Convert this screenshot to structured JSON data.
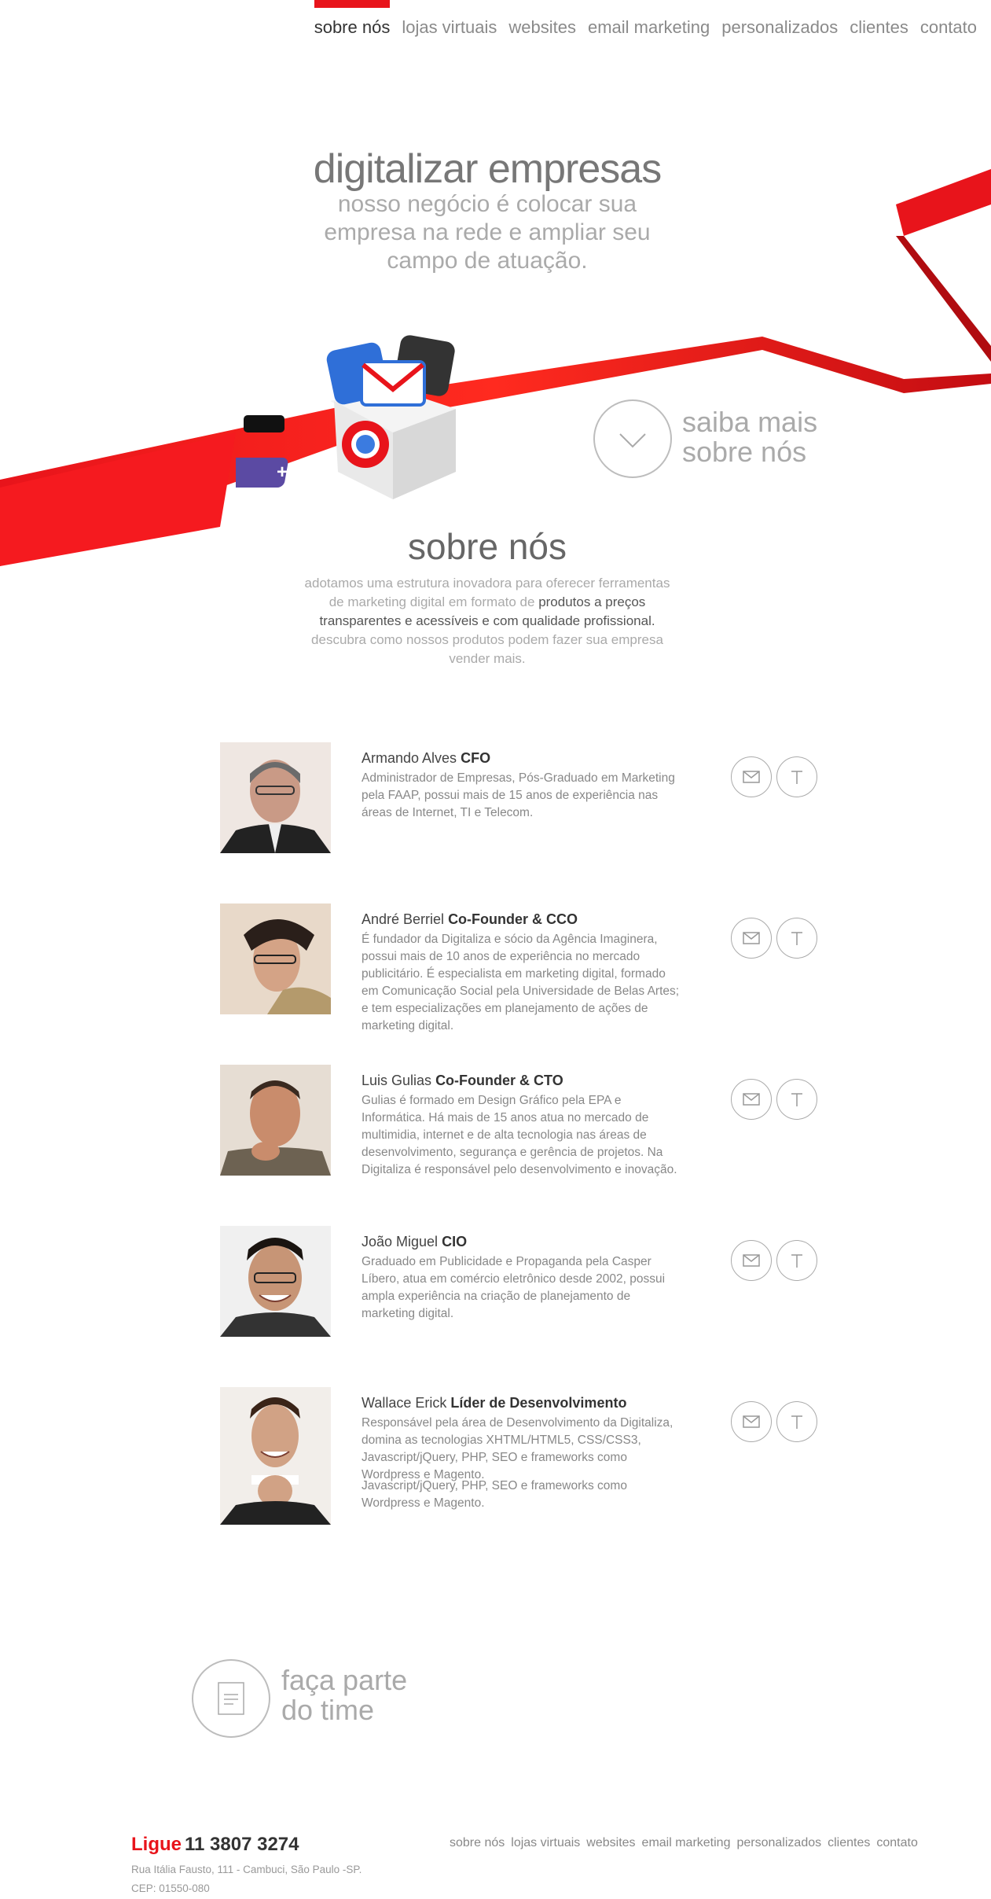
{
  "nav": {
    "items": [
      "sobre nós",
      "lojas virtuais",
      "websites",
      "email marketing",
      "personalizados",
      "clientes",
      "contato"
    ],
    "active_index": 0
  },
  "hero": {
    "title": "digitalizar empresas",
    "subtitle": "nosso negócio é colocar sua empresa na rede e ampliar seu campo de atuação."
  },
  "saiba": {
    "line1": "saiba mais",
    "line2": "sobre nós"
  },
  "about": {
    "title": "sobre nós",
    "text_before": "adotamos uma estrutura inovadora para oferecer ferramentas de marketing digital em formato de ",
    "text_highlight": "produtos a preços transparentes e acessíveis e com qualidade profissional.",
    "text_after": " descubra como nossos produtos podem fazer sua empresa vender mais."
  },
  "team": [
    {
      "name": "Armando Alves",
      "role": "CFO",
      "bio": "Administrador de Empresas, Pós-Graduado em Marketing pela FAAP, possui mais de 15 anos de experiência nas áreas de Internet, TI e Telecom."
    },
    {
      "name": "André Berriel",
      "role": "Co-Founder & CCO",
      "bio": "É fundador da Digitaliza e sócio da Agência Imaginera, possui mais de 10 anos de experiência no mercado publicitário. É especialista em marketing digital, formado em Comunicação Social pela Universidade de Belas Artes; e tem especializações em planejamento de ações de marketing digital."
    },
    {
      "name": "Luis Gulias",
      "role": "Co-Founder & CTO",
      "bio": "Gulias é formado em Design Gráfico pela EPA e Informática. Há mais de 15 anos atua no mercado de multimidia, internet e de alta tecnologia nas áreas de desenvolvimento, segurança e gerência de projetos. Na Digitaliza é responsável pelo desenvolvimento e inovação."
    },
    {
      "name": "João Miguel",
      "role": "CIO",
      "bio": "Graduado em Publicidade e Propaganda pela Casper Líbero, atua em comércio eletrônico desde 2002, possui ampla experiência na criação de planejamento de marketing digital."
    },
    {
      "name": "Wallace Erick",
      "role": "Líder de Desenvolvimento",
      "bio": "Responsável pela área de Desenvolvimento da Digitaliza, domina as tecnologias XHTML/HTML5, CSS/CSS3, Javascript/jQuery, PHP, SEO e frameworks como Wordpress e Magento.",
      "bio_extra": "Javascript/jQuery, PHP, SEO e frameworks como Wordpress e Magento."
    }
  ],
  "join": {
    "line1": "faça parte",
    "line2": "do time"
  },
  "footer": {
    "ligue": "Ligue",
    "phone": "11 3807 3274",
    "address": "Rua Itália Fausto, 111 - Cambuci, São Paulo -SP.",
    "cep": "CEP: 01550-080",
    "nav": [
      "sobre nós",
      "lojas virtuais",
      "websites",
      "email marketing",
      "personalizados",
      "clientes",
      "contato"
    ]
  },
  "colors": {
    "brand_red": "#e8141b",
    "text_gray": "#888888"
  },
  "icons": [
    "mail-icon",
    "twitter-icon",
    "document-icon",
    "chevron-down-icon",
    "gift-box-icon"
  ]
}
